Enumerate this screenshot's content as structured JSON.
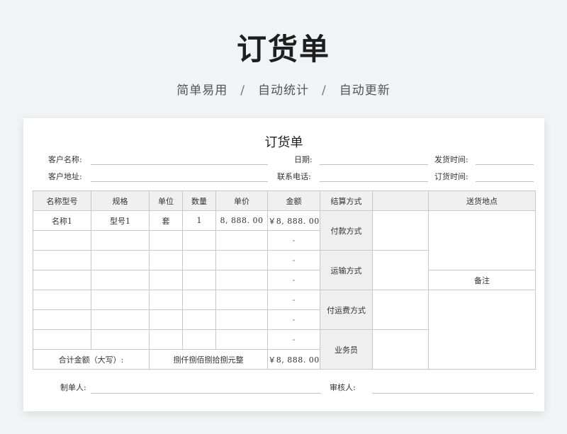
{
  "hero": {
    "title": "订货单",
    "features": [
      "简单易用",
      "自动统计",
      "自动更新"
    ],
    "separator": "/"
  },
  "document": {
    "title": "订货单",
    "fields": {
      "customer_name": "客户名称:",
      "date": "日期:",
      "ship_time": "发货时间:",
      "customer_address": "客户地址:",
      "phone": "联系电话:",
      "order_time": "订货时间:"
    },
    "table": {
      "headers": [
        "名称型号",
        "规格",
        "单位",
        "数量",
        "单价",
        "金额",
        "结算方式",
        "",
        "送货地点"
      ],
      "rows": [
        [
          "名称1",
          "型号1",
          "套",
          "1",
          "8, 888. 00",
          "￥8, 888. 00"
        ],
        [
          "",
          "",
          "",
          "",
          "",
          "-"
        ],
        [
          "",
          "",
          "",
          "",
          "",
          "-"
        ],
        [
          "",
          "",
          "",
          "",
          "",
          "-"
        ],
        [
          "",
          "",
          "",
          "",
          "",
          "-"
        ],
        [
          "",
          "",
          "",
          "",
          "",
          "-"
        ],
        [
          "",
          "",
          "",
          "",
          "",
          "-"
        ]
      ],
      "settlement": [
        "付款方式",
        "运输方式",
        "付运费方式",
        "业务员"
      ],
      "remarks_label": "备注",
      "total_label": "合计金额（大写）:",
      "total_words": "捌仟捌佰捌拾捌元整",
      "total_amount": "￥8, 888. 00"
    },
    "footer": {
      "maker": "制单人:",
      "reviewer": "审核人:"
    }
  }
}
